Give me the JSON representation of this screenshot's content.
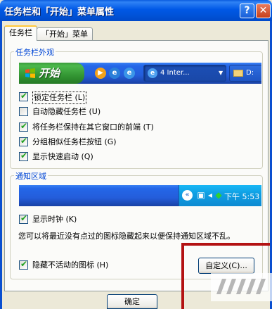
{
  "window": {
    "title": "任务栏和「开始」菜单属性",
    "help_btn": "?",
    "close_btn": "✕"
  },
  "tabs": [
    {
      "label": "任务栏",
      "active": true
    },
    {
      "label": "「开始」菜单",
      "active": false
    }
  ],
  "taskbar_group": {
    "legend": "任务栏外观",
    "preview": {
      "start_label": "开始",
      "quick_launch_icons": [
        "media-player-icon",
        "ie-icon",
        "ie-alt-icon"
      ],
      "task_buttons": [
        {
          "label": "4 Inter...",
          "icon": "ie-icon",
          "active": true,
          "has_dropdown": true
        },
        {
          "label": "D:",
          "icon": "folder-icon",
          "active": false
        }
      ]
    },
    "options": [
      {
        "label": "锁定任务栏 (L)",
        "checked": true
      },
      {
        "label": "自动隐藏任务栏 (U)",
        "checked": false
      },
      {
        "label": "将任务栏保持在其它窗口的前端 (T)",
        "checked": true
      },
      {
        "label": "分组相似任务栏按钮 (G)",
        "checked": true
      },
      {
        "label": "显示快速启动 (Q)",
        "checked": true
      }
    ]
  },
  "notification_group": {
    "legend": "通知区域",
    "preview": {
      "clock": "下午 5:53",
      "tray_icons": [
        "expand-chevron-icon",
        "network-icon",
        "speaker-icon",
        "shield-icon"
      ]
    },
    "show_clock": {
      "label": "显示时钟 (K)",
      "checked": true
    },
    "description": "您可以将最近没有点过的图标隐藏起来以便保持通知区域不乱。",
    "hide_inactive": {
      "label": "隐藏不活动的图标 (H)",
      "checked": true
    },
    "customize_btn": "自定义(C)..."
  },
  "footer": {
    "ok_btn": "确定"
  },
  "colors": {
    "title_bar": "#0058e6",
    "legend_text": "#0046d5",
    "start_button": "#3c9c3c",
    "taskbar": "#245ddb",
    "tray": "#0f9fe3",
    "annotation": "#b31212"
  }
}
